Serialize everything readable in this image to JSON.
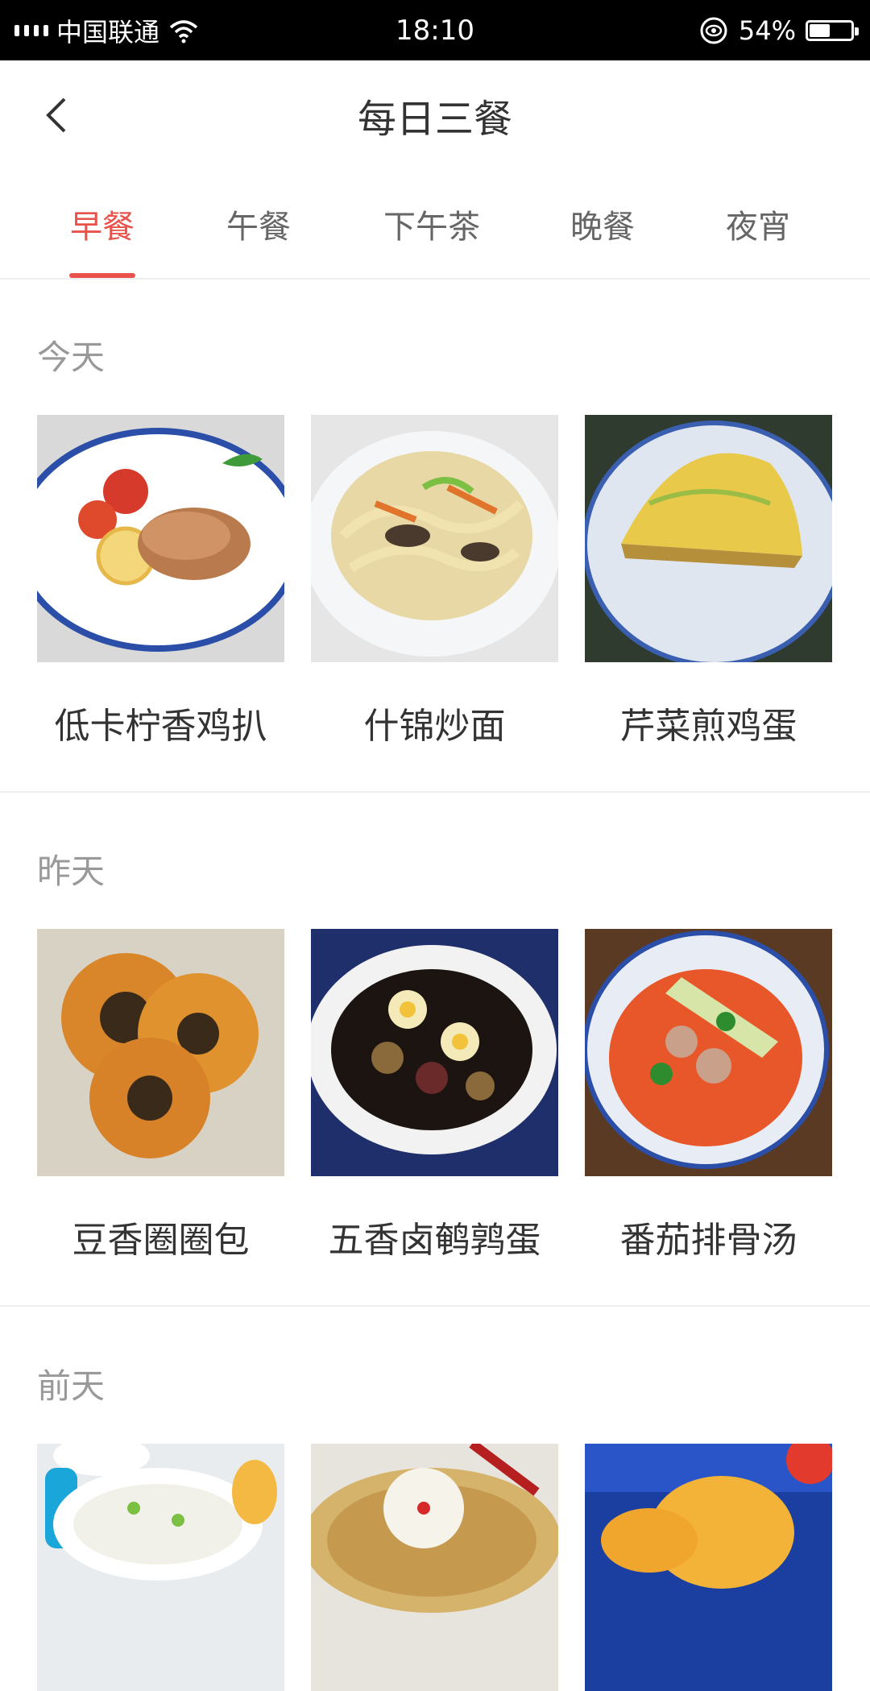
{
  "status_bar": {
    "carrier": "中国联通",
    "time": "18:10",
    "battery_pct": "54%",
    "battery_level": 0.54
  },
  "header": {
    "title": "每日三餐"
  },
  "tabs": [
    {
      "label": "早餐",
      "active": true
    },
    {
      "label": "午餐",
      "active": false
    },
    {
      "label": "下午茶",
      "active": false
    },
    {
      "label": "晚餐",
      "active": false
    },
    {
      "label": "夜宵",
      "active": false
    }
  ],
  "sections": [
    {
      "label": "今天",
      "items": [
        {
          "name": "低卡柠香鸡扒"
        },
        {
          "name": "什锦炒面"
        },
        {
          "name": "芹菜煎鸡蛋"
        }
      ]
    },
    {
      "label": "昨天",
      "items": [
        {
          "name": "豆香圈圈包"
        },
        {
          "name": "五香卤鹌鹑蛋"
        },
        {
          "name": "番茄排骨汤"
        }
      ]
    },
    {
      "label": "前天",
      "items": [
        {
          "name": ""
        },
        {
          "name": ""
        },
        {
          "name": ""
        }
      ]
    }
  ],
  "colors": {
    "accent": "#e8524a",
    "text": "#333333",
    "muted": "#999999"
  }
}
